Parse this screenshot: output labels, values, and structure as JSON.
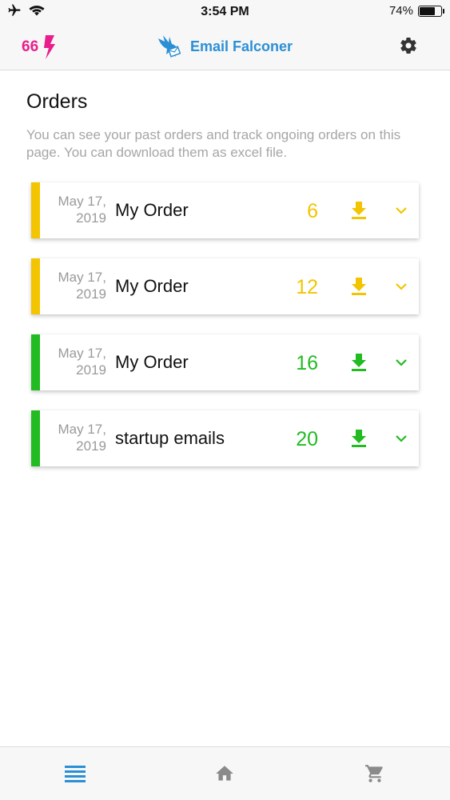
{
  "status_bar": {
    "time": "3:54 PM",
    "battery": "74%",
    "battery_level": 0.74
  },
  "header": {
    "credits": "66",
    "app_name": "Email Falconer",
    "credits_color": "#e91e8c",
    "brand_color": "#2b8fd6"
  },
  "page": {
    "title": "Orders",
    "description": "You can see your past orders and track ongoing orders on this page. You can download them as excel file."
  },
  "orders": [
    {
      "date_line1": "May 17,",
      "date_line2": "2019",
      "name": "My Order",
      "count": "6",
      "status_color": "#f2c500"
    },
    {
      "date_line1": "May 17,",
      "date_line2": "2019",
      "name": "My Order",
      "count": "12",
      "status_color": "#f2c500"
    },
    {
      "date_line1": "May 17,",
      "date_line2": "2019",
      "name": "My Order",
      "count": "16",
      "status_color": "#22bb22"
    },
    {
      "date_line1": "May 17,",
      "date_line2": "2019",
      "name": "startup emails",
      "count": "20",
      "status_color": "#22bb22"
    }
  ],
  "bottom_nav": {
    "items": [
      {
        "icon": "menu-list-icon",
        "active": true
      },
      {
        "icon": "home-icon",
        "active": false
      },
      {
        "icon": "cart-icon",
        "active": false
      }
    ],
    "active_color": "#2b8fd6",
    "inactive_color": "#8a8a8a"
  }
}
